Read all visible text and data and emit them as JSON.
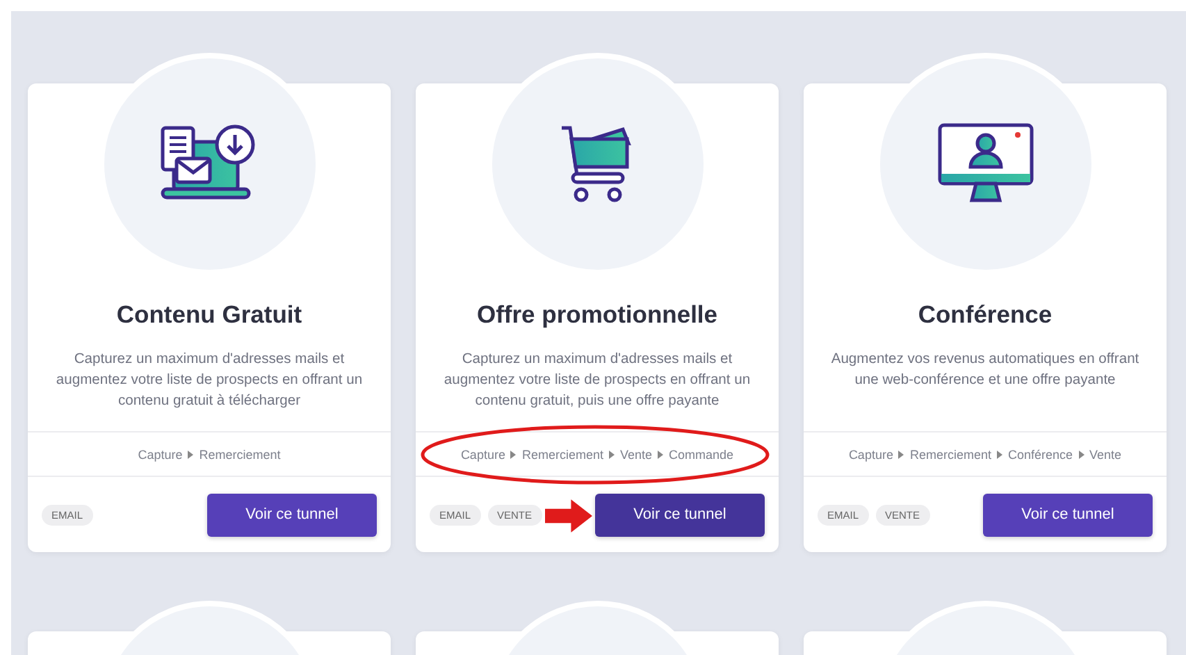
{
  "cards": [
    {
      "kind": "download",
      "title": "Contenu Gratuit",
      "description": "Capturez un maximum d'adresses mails et augmentez votre liste de prospects en offrant un contenu gratuit à télécharger",
      "steps": [
        "Capture",
        "Remerciement"
      ],
      "tags": [
        "EMAIL"
      ],
      "button": "Voir ce tunnel",
      "button_hovered": false,
      "highlighted": false
    },
    {
      "kind": "sale",
      "title": "Offre promotionnelle",
      "description": "Capturez un maximum d'adresses mails et augmentez votre liste de prospects en offrant un contenu gratuit, puis une offre payante",
      "steps": [
        "Capture",
        "Remerciement",
        "Vente",
        "Commande"
      ],
      "tags": [
        "EMAIL",
        "VENTE"
      ],
      "button": "Voir ce tunnel",
      "button_hovered": true,
      "highlighted": true
    },
    {
      "kind": "webinar",
      "title": "Conférence",
      "description": "Augmentez vos revenus automatiques en offrant une web-conférence et une offre payante",
      "steps": [
        "Capture",
        "Remerciement",
        "Conférence",
        "Vente"
      ],
      "tags": [
        "EMAIL",
        "VENTE"
      ],
      "button": "Voir ce tunnel",
      "button_hovered": false,
      "highlighted": false
    }
  ],
  "next_row_cards": [
    {
      "kind": "card"
    },
    {
      "kind": "card"
    },
    {
      "kind": "card"
    }
  ]
}
